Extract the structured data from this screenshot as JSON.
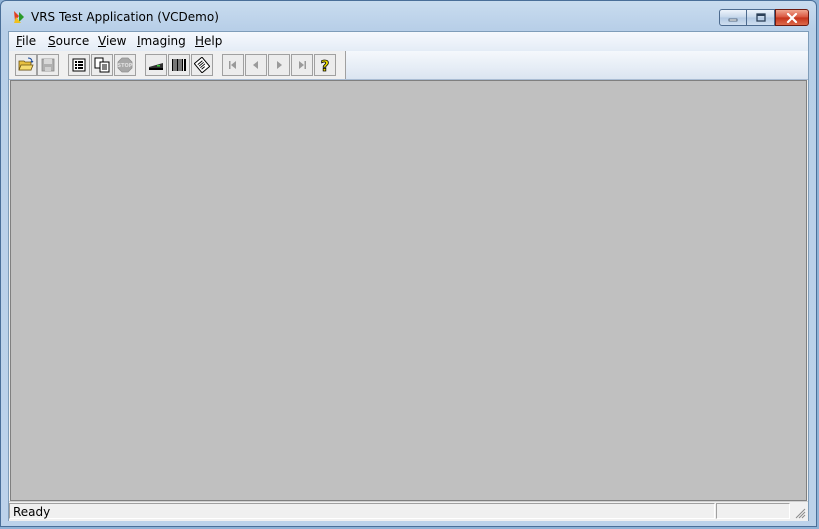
{
  "window": {
    "title": "VRS Test Application (VCDemo)",
    "icon": "app-icon",
    "caption_buttons": [
      "minimize-icon",
      "maximize-icon",
      "close-icon"
    ]
  },
  "menu": {
    "items": [
      {
        "label": "File"
      },
      {
        "label": "Source"
      },
      {
        "label": "View"
      },
      {
        "label": "Imaging"
      },
      {
        "label": "Help"
      }
    ]
  },
  "toolbar": {
    "buttons": [
      {
        "icon": "open-folder-icon",
        "enabled": true
      },
      {
        "icon": "save-icon",
        "enabled": false
      },
      {
        "icon": "properties-icon",
        "enabled": true
      },
      {
        "icon": "copy-pages-icon",
        "enabled": true
      },
      {
        "icon": "stop-icon",
        "enabled": false,
        "label": "STOP"
      },
      {
        "icon": "scanner-icon",
        "enabled": true
      },
      {
        "icon": "barcode-icon",
        "enabled": true
      },
      {
        "icon": "rotate-page-icon",
        "enabled": true
      },
      {
        "icon": "first-page-icon",
        "enabled": false
      },
      {
        "icon": "previous-page-icon",
        "enabled": false
      },
      {
        "icon": "next-page-icon",
        "enabled": false
      },
      {
        "icon": "last-page-icon",
        "enabled": false
      },
      {
        "icon": "help-icon",
        "enabled": true,
        "label": "?"
      }
    ]
  },
  "status": {
    "text": "Ready"
  },
  "colors": {
    "workspace": "#c0c0c0",
    "close_button": "#c4321a"
  }
}
